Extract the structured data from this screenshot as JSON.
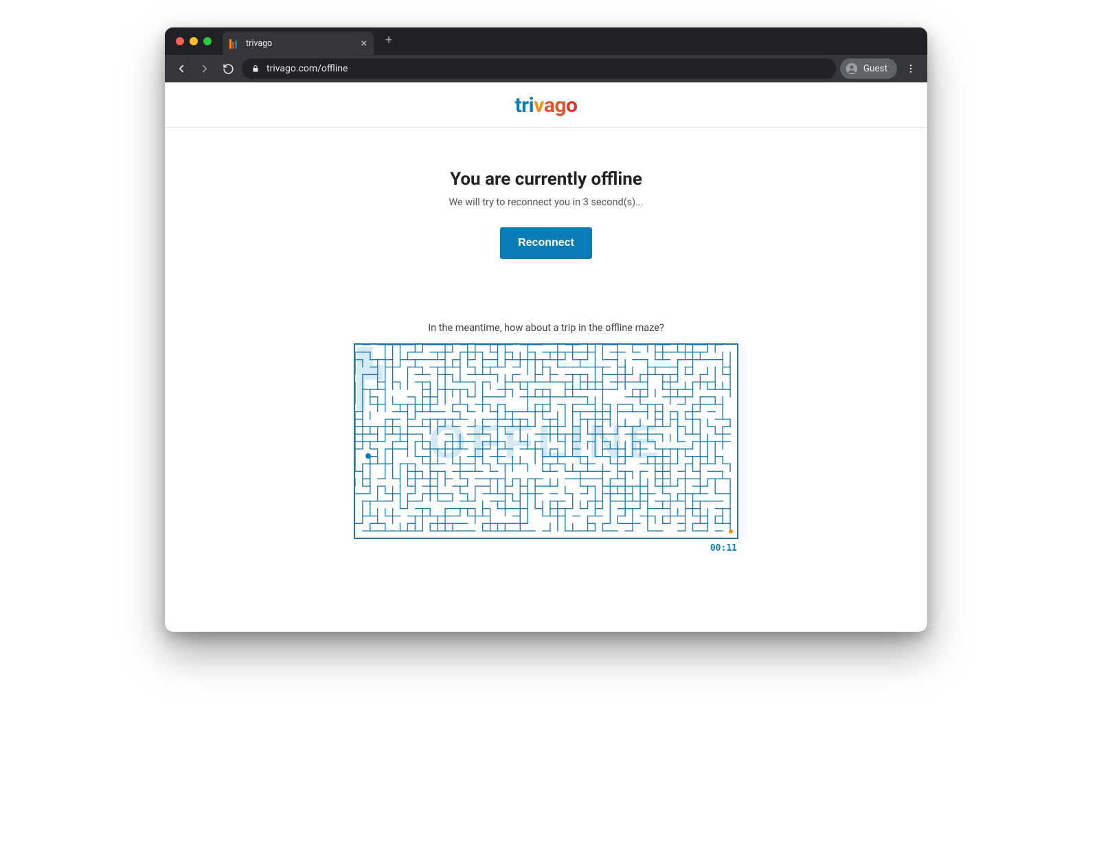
{
  "browser": {
    "tab_title": "trivago",
    "url": "trivago.com/offline",
    "guest_label": "Guest"
  },
  "brand": {
    "name_letters": [
      "t",
      "r",
      "i",
      "v",
      "a",
      "g",
      "o"
    ]
  },
  "offline": {
    "heading": "You are currently offline",
    "subtext": "We will try to reconnect you in 3 second(s)...",
    "reconnect_label": "Reconnect",
    "meanwhile": "In the meantime, how about a trip in the offline maze?",
    "maze_word": "OFFLINE",
    "timer": "00:11"
  },
  "colors": {
    "accent": "#0a7db9",
    "orange": "#f39019",
    "red": "#d7382b"
  }
}
